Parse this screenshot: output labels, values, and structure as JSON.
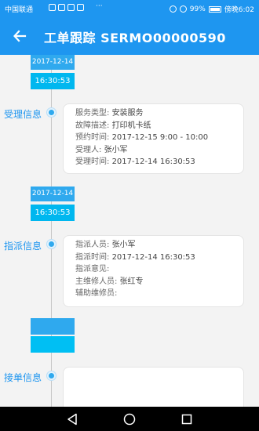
{
  "status_bar": {
    "carrier": "中国联通",
    "more": "···",
    "battery": "99%",
    "time": "傍晚6:02"
  },
  "header": {
    "title": "工单跟踪  SERMO00000590",
    "back_icon": "arrow-left-icon"
  },
  "timeline": [
    {
      "date": "2017-12-14",
      "time": "16:30:53",
      "section": "受理信息",
      "fields": [
        {
          "label": "服务类型:",
          "value": "安装服务"
        },
        {
          "label": "故障描述:",
          "value": "打印机卡纸"
        },
        {
          "label": "预约时间:",
          "value": "2017-12-15 9:00 - 10:00"
        },
        {
          "label": "受理人:",
          "value": "张小军"
        },
        {
          "label": "受理时间:",
          "value": "2017-12-14 16:30:53"
        }
      ]
    },
    {
      "date": "2017-12-14",
      "time": "16:30:53",
      "section": "指派信息",
      "fields": [
        {
          "label": "指派人员:",
          "value": "张小军"
        },
        {
          "label": "指派时间:",
          "value": "2017-12-14 16:30:53"
        },
        {
          "label": "指派意见:",
          "value": ""
        },
        {
          "label": "主维修人员:",
          "value": "张红专"
        },
        {
          "label": "辅助维修员:",
          "value": ""
        }
      ]
    },
    {
      "date": "",
      "time": "",
      "section": "接单信息",
      "fields": []
    }
  ],
  "colors": {
    "primary": "#1e96f0",
    "date_tag": "#2fa9ee",
    "time_tag": "#00b7ef"
  }
}
